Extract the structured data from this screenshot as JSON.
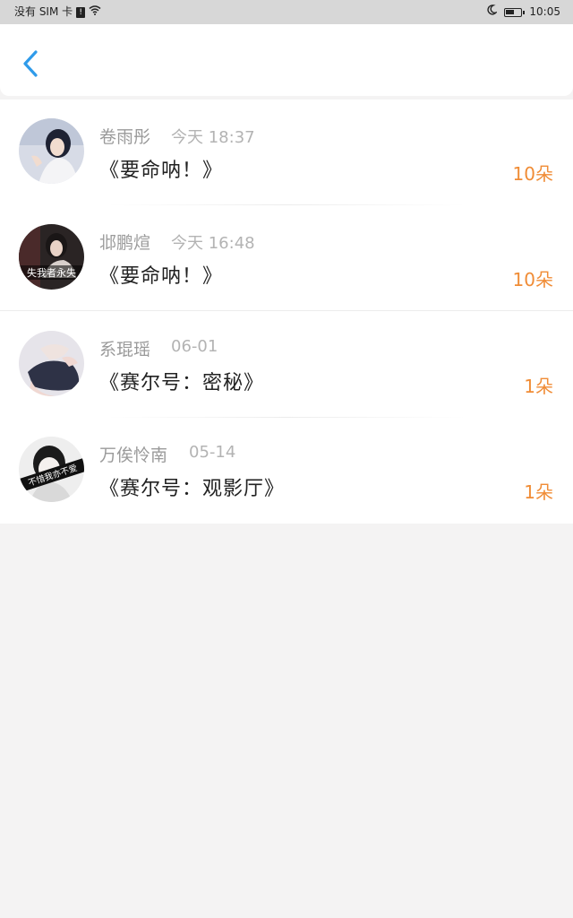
{
  "status_bar": {
    "carrier": "没有 SIM 卡",
    "sim_badge": "!",
    "time": "10:05",
    "icons": [
      "sim-alert-icon",
      "wifi-icon",
      "moon-icon",
      "battery-icon"
    ]
  },
  "header": {
    "back_icon": "chevron-left-icon",
    "accent_color": "#2f9bea"
  },
  "gifts": [
    {
      "name": "卷雨彤",
      "time": "今天 18:37",
      "title": "《要命呐！》",
      "count": "10朵"
    },
    {
      "name": "邶鹏煊",
      "time": "今天 16:48",
      "title": "《要命呐！》",
      "count": "10朵",
      "avatar_caption": "失我者永失"
    },
    {
      "name": "系琨瑶",
      "time": "06-01",
      "title": "《赛尔号：密秘》",
      "count": "1朵"
    },
    {
      "name": "万俟怜南",
      "time": "05-14",
      "title": "《赛尔号：观影厅》",
      "count": "1朵",
      "avatar_caption": "不惜我亦不爱"
    }
  ],
  "colors": {
    "count": "#f08c36",
    "name": "#9a9a9a",
    "time": "#b3b3b3",
    "title": "#222222"
  }
}
